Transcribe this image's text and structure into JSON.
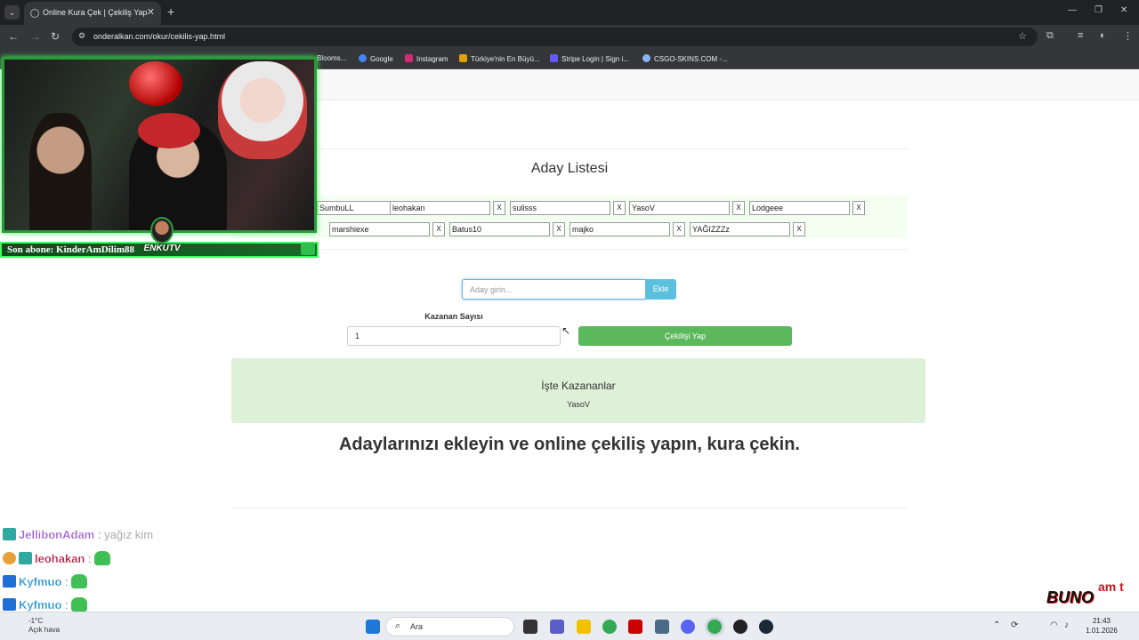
{
  "browser": {
    "tab_title": "Online Kura Çek | Çekiliş Yap",
    "url": "onderalkan.com/okur/cekilis-yap.html",
    "bookmarks": [
      "Blooms...",
      "Google",
      "Instagram",
      "Türkiye'nin En Büyü...",
      "Stripe Login | Sign i...",
      "CSGO-SKINS.COM -..."
    ]
  },
  "page": {
    "list_title": "Aday Listesi",
    "candidates": [
      {
        "name": "SumbuLL",
        "remove": "X"
      },
      {
        "name": "leohakan",
        "remove": "X"
      },
      {
        "name": "sulisss",
        "remove": "X"
      },
      {
        "name": "YasoV",
        "remove": "X"
      },
      {
        "name": "Lodgeee",
        "remove": "X"
      },
      {
        "name": "marshiexe",
        "remove": "X"
      },
      {
        "name": "Batus10",
        "remove": "X"
      },
      {
        "name": "majko",
        "remove": "X"
      },
      {
        "name": "YAĞIZZZz",
        "remove": "X"
      }
    ],
    "add_placeholder": "Aday girin...",
    "add_button": "Ekle",
    "winner_count_label": "Kazanan Sayısı",
    "winner_count_value": "1",
    "draw_button": "Çekilişi Yap",
    "winners_title": "İşte Kazananlar",
    "winners": "YasoV",
    "headline": "Adaylarınızı ekleyin ve online çekiliş yapın, kura çekin."
  },
  "overlay": {
    "sub_text": "Son abone: KinderAmDilim",
    "sub_suffix": "88",
    "channel_badge": "ENKUTV",
    "chat": [
      {
        "user": "JellibonAdam",
        "sep": ":",
        "msg": "yağız kim",
        "color": "#9b59d6"
      },
      {
        "user": "leohakan",
        "sep": ":",
        "msg": "",
        "color": "#b3123a"
      },
      {
        "user": "Kyfmuo",
        "sep": ":",
        "msg": "",
        "color": "#1e8fd6"
      },
      {
        "user": "Kyfmuo",
        "sep": ":",
        "msg": "",
        "color": "#1e8fd6"
      }
    ],
    "brand_text": "BUNO",
    "brand_tail": "am t"
  },
  "taskbar": {
    "search_placeholder": "Ara",
    "weather_temp": "-1°C",
    "weather_desc": "Açık hava",
    "time": "21:43",
    "date": "1.01.2026"
  },
  "colors": {
    "accent_info": "#5bc0de",
    "accent_success": "#5cb85c",
    "winners_bg": "#dff0d8",
    "overlay_green": "#2b9a3a"
  }
}
